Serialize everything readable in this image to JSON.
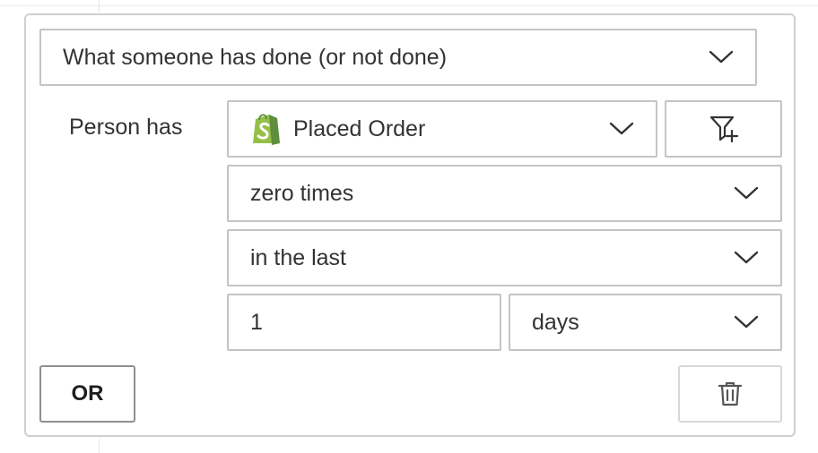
{
  "condition": {
    "type_select": {
      "value": "What someone has done (or not done)",
      "icon": "chevron-down-icon"
    },
    "person_label": "Person has",
    "metric_select": {
      "value": "Placed Order",
      "source_icon": "shopify-icon",
      "icon": "chevron-down-icon"
    },
    "filter_button": {
      "icon": "add-filter-icon"
    },
    "frequency_select": {
      "value": "zero times",
      "icon": "chevron-down-icon"
    },
    "timeframe_select": {
      "value": "in the last",
      "icon": "chevron-down-icon"
    },
    "timeframe_value_input": {
      "value": "1"
    },
    "timeframe_unit_select": {
      "value": "days",
      "icon": "chevron-down-icon"
    }
  },
  "footer": {
    "or_button_label": "OR",
    "delete_button": {
      "icon": "trash-icon"
    }
  },
  "colors": {
    "border": "#c4c4c4",
    "card_border": "#cfcfcf",
    "text": "#333333",
    "shopify_green": "#95bf47",
    "shopify_dark": "#5e8e3e"
  }
}
